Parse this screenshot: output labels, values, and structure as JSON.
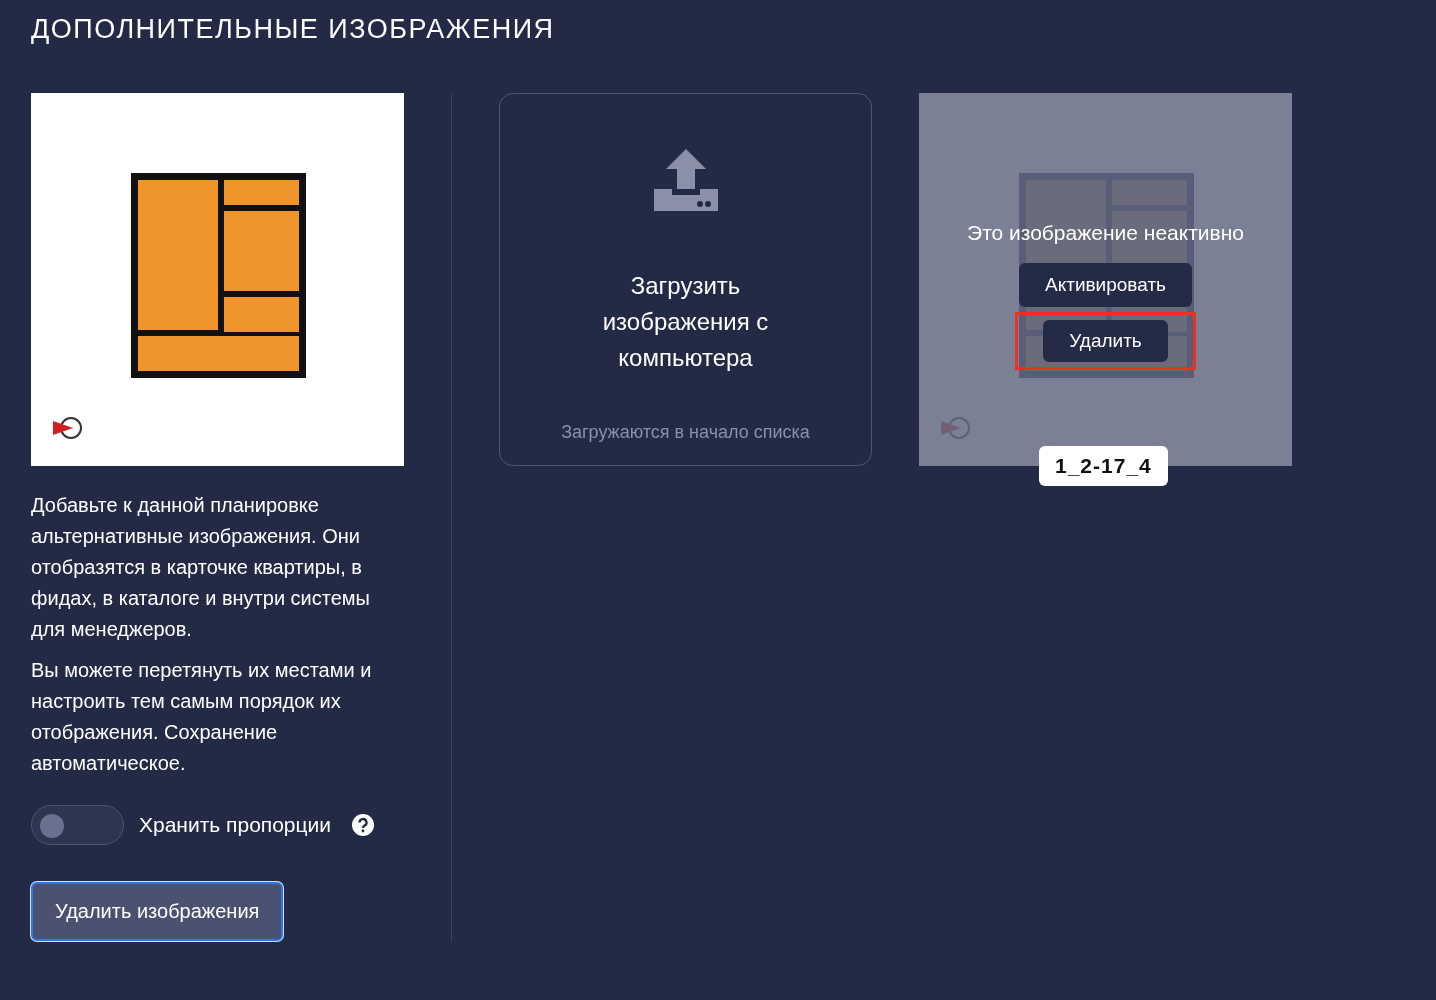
{
  "title": "ДОПОЛНИТЕЛЬНЫЕ ИЗОБРАЖЕНИЯ",
  "description": [
    "Добавьте к данной планировке альтернативные изображения. Они отобразятся в карточке квартиры, в фидах, в каталоге и внутри системы для менеджеров.",
    "Вы можете перетянуть их местами и настроить тем самым порядок их отображения. Сохранение автоматическое."
  ],
  "keep_proportions": {
    "label": "Хранить пропорции",
    "on": false
  },
  "delete_images_button": {
    "label": "Удалить изображения",
    "focused": true
  },
  "upload": {
    "title": "Загрузить изображения с компьютера",
    "hint": "Загружаются в начало списка"
  },
  "gallery": [
    {
      "caption": "1_2-17_4",
      "active": false,
      "inactive_text": "Это изображение неактивно",
      "activate_label": "Активировать",
      "delete_label": "Удалить",
      "delete_highlighted": true
    }
  ]
}
